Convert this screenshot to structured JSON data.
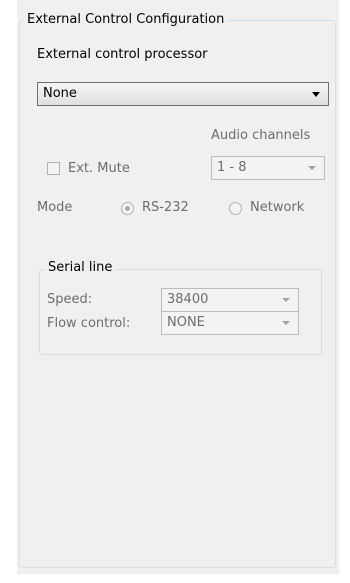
{
  "group": {
    "title": "External Control Configuration"
  },
  "processor": {
    "label": "External control processor",
    "selected": "None"
  },
  "audio": {
    "label": "Audio channels",
    "selected": "1 - 8"
  },
  "ext_mute": {
    "label": "Ext. Mute",
    "checked": false
  },
  "mode": {
    "label": "Mode",
    "options": [
      {
        "label": "RS-232",
        "selected": true
      },
      {
        "label": "Network",
        "selected": false
      }
    ]
  },
  "serial": {
    "title": "Serial line",
    "speed_label": "Speed:",
    "speed_value": "38400",
    "flow_label": "Flow control:",
    "flow_value": "NONE"
  }
}
